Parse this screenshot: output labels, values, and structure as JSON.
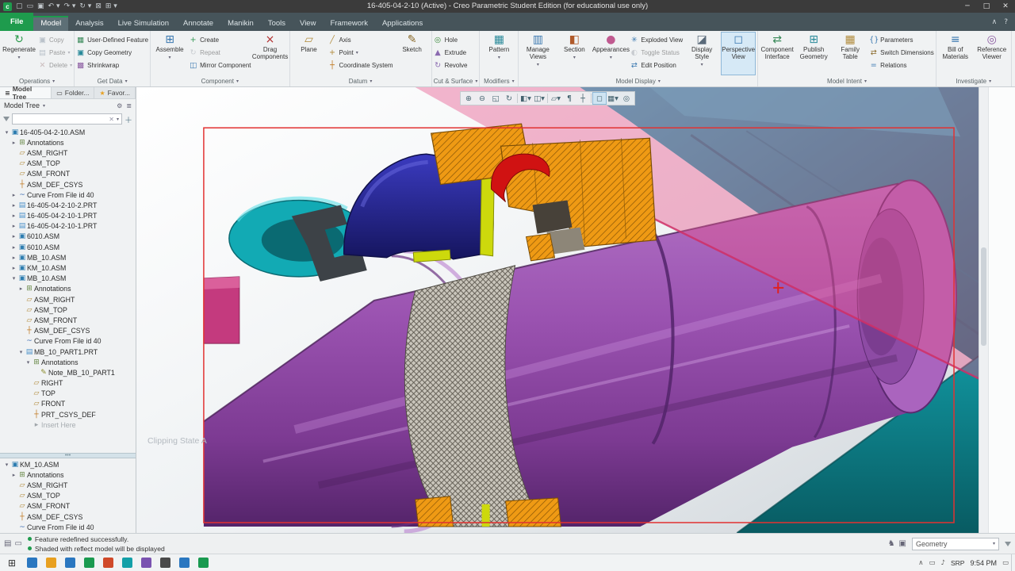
{
  "window": {
    "title": "16-405-04-2-10 (Active) - Creo Parametric Student Edition (for educational use only)",
    "quick_access": [
      {
        "name": "new-file-icon",
        "glyph": "▢"
      },
      {
        "name": "open-icon",
        "glyph": "▭"
      },
      {
        "name": "save-icon",
        "glyph": "▣"
      },
      {
        "name": "undo-icon",
        "glyph": "↶",
        "caret": true
      },
      {
        "name": "redo-icon",
        "glyph": "↷",
        "caret": true
      },
      {
        "name": "regenerate-icon",
        "glyph": "↻",
        "caret": true
      },
      {
        "name": "close-window-icon",
        "glyph": "⊠"
      },
      {
        "name": "windows-icon",
        "glyph": "⊞",
        "caret": true
      }
    ],
    "controls": [
      {
        "name": "minimize-button",
        "glyph": "─"
      },
      {
        "name": "maximize-button",
        "glyph": "□"
      },
      {
        "name": "close-button",
        "glyph": "✕"
      }
    ]
  },
  "colors": {
    "accent_green": "#1e9b4d",
    "shaft_purple": "#9a52b0",
    "housing_teal": "#10a8b2",
    "bearing_orange": "#ef9a14",
    "clip_pink": "#e8538b",
    "part_red": "#d01212",
    "part_blue": "#2a2aa8",
    "part_yellow": "#cdd90c",
    "selection_red": "#e23232"
  },
  "ribbon": {
    "tabs": [
      {
        "label": "File",
        "file": true
      },
      {
        "label": "Model",
        "active": true
      },
      {
        "label": "Analysis"
      },
      {
        "label": "Live Simulation"
      },
      {
        "label": "Annotate"
      },
      {
        "label": "Manikin"
      },
      {
        "label": "Tools"
      },
      {
        "label": "View"
      },
      {
        "label": "Framework"
      },
      {
        "label": "Applications"
      }
    ],
    "right_icons": [
      {
        "name": "minimize-ribbon-icon",
        "glyph": "∧"
      },
      {
        "name": "help-icon",
        "glyph": "?"
      }
    ],
    "groups": [
      {
        "label": "Operations",
        "items": [
          {
            "type": "big",
            "label": "Regenerate",
            "icon": "regenerate-icon",
            "caret": true
          },
          {
            "type": "col",
            "buttons": [
              {
                "label": "Copy",
                "icon": "copy-icon",
                "disabled": true
              },
              {
                "label": "Paste",
                "icon": "paste-icon",
                "disabled": true,
                "caret": true
              },
              {
                "label": "Delete",
                "icon": "delete-icon",
                "disabled": true,
                "caret": true
              }
            ]
          }
        ]
      },
      {
        "label": "Get Data",
        "items": [
          {
            "type": "col",
            "buttons": [
              {
                "label": "User-Defined Feature",
                "icon": "udf-icon"
              },
              {
                "label": "Copy Geometry",
                "icon": "copy-geometry-icon"
              },
              {
                "label": "Shrinkwrap",
                "icon": "shrinkwrap-icon"
              }
            ]
          }
        ]
      },
      {
        "label": "Component",
        "items": [
          {
            "type": "big",
            "label": "Assemble",
            "icon": "assemble-icon",
            "caret": true
          },
          {
            "type": "col",
            "buttons": [
              {
                "label": "Create",
                "icon": "create-icon"
              },
              {
                "label": "Repeat",
                "icon": "repeat-icon",
                "disabled": true
              },
              {
                "label": "Mirror Component",
                "icon": "mirror-icon"
              }
            ]
          },
          {
            "type": "big",
            "label": "Drag Components",
            "icon": "drag-components-icon"
          }
        ]
      },
      {
        "label": "Datum",
        "items": [
          {
            "type": "big",
            "label": "Plane",
            "icon": "plane-icon"
          },
          {
            "type": "col",
            "buttons": [
              {
                "label": "Axis",
                "icon": "axis-icon"
              },
              {
                "label": "Point",
                "icon": "point-icon",
                "caret": true
              },
              {
                "label": "Coordinate System",
                "icon": "csys-icon"
              }
            ]
          },
          {
            "type": "big",
            "label": "Sketch",
            "icon": "sketch-icon"
          }
        ]
      },
      {
        "label": "Cut & Surface",
        "items": [
          {
            "type": "col",
            "buttons": [
              {
                "label": "Hole",
                "icon": "hole-icon"
              },
              {
                "label": "Extrude",
                "icon": "extrude-icon"
              },
              {
                "label": "Revolve",
                "icon": "revolve-icon"
              }
            ]
          }
        ]
      },
      {
        "label": "Modifiers",
        "items": [
          {
            "type": "big",
            "label": "Pattern",
            "icon": "pattern-icon",
            "caret": true
          }
        ]
      },
      {
        "label": "Model Display",
        "items": [
          {
            "type": "big",
            "label": "Manage Views",
            "icon": "manage-views-icon",
            "caret": true
          },
          {
            "type": "big",
            "label": "Section",
            "icon": "section-icon",
            "caret": true
          },
          {
            "type": "big",
            "label": "Appearances",
            "icon": "appearances-icon",
            "caret": true
          },
          {
            "type": "col",
            "buttons": [
              {
                "label": "Exploded View",
                "icon": "exploded-view-icon"
              },
              {
                "label": "Toggle Status",
                "icon": "toggle-status-icon",
                "disabled": true
              },
              {
                "label": "Edit Position",
                "icon": "edit-position-icon"
              }
            ]
          },
          {
            "type": "big",
            "label": "Display Style",
            "icon": "display-style-icon",
            "caret": true
          },
          {
            "type": "big",
            "label": "Perspective View",
            "icon": "perspective-view-icon",
            "active": true
          }
        ]
      },
      {
        "label": "Model Intent",
        "items": [
          {
            "type": "big",
            "label": "Component Interface",
            "icon": "component-interface-icon"
          },
          {
            "type": "big",
            "label": "Publish Geometry",
            "icon": "publish-geometry-icon"
          },
          {
            "type": "big",
            "label": "Family Table",
            "icon": "family-table-icon"
          },
          {
            "type": "col",
            "buttons": [
              {
                "label": "Parameters",
                "icon": "parameters-icon"
              },
              {
                "label": "Switch Dimensions",
                "icon": "switch-dimensions-icon"
              },
              {
                "label": "Relations",
                "icon": "relations-icon"
              }
            ]
          }
        ]
      },
      {
        "label": "Investigate",
        "items": [
          {
            "type": "big",
            "label": "Bill of Materials",
            "icon": "bom-icon"
          },
          {
            "type": "big",
            "label": "Reference Viewer",
            "icon": "reference-viewer-icon"
          }
        ]
      }
    ]
  },
  "left_panel": {
    "tabs": [
      {
        "label": "Model Tree",
        "icon": "tree-icon",
        "glyph": "≡",
        "active": true
      },
      {
        "label": "Folder...",
        "icon": "folder-icon",
        "glyph": "▭"
      },
      {
        "label": "Favor...",
        "icon": "star-icon",
        "glyph": "★"
      }
    ],
    "header": {
      "label": "Model Tree"
    },
    "filter": {
      "placeholder": ""
    },
    "tree1": [
      {
        "label": "16-405-04-2-10.ASM",
        "level": 0,
        "icon": "assembly-icon",
        "expand": "down"
      },
      {
        "label": "Annotations",
        "level": 1,
        "icon": "annotations-icon",
        "expand": "right"
      },
      {
        "label": "ASM_RIGHT",
        "level": 1,
        "icon": "plane-icon"
      },
      {
        "label": "ASM_TOP",
        "level": 1,
        "icon": "plane-icon"
      },
      {
        "label": "ASM_FRONT",
        "level": 1,
        "icon": "plane-icon"
      },
      {
        "label": "ASM_DEF_CSYS",
        "level": 1,
        "icon": "csys-icon"
      },
      {
        "label": "Curve From File id 40",
        "level": 1,
        "icon": "curve-icon",
        "expand": "right"
      },
      {
        "label": "16-405-04-2-10-2.PRT",
        "level": 1,
        "icon": "part-icon",
        "expand": "right"
      },
      {
        "label": "16-405-04-2-10-1.PRT",
        "level": 1,
        "icon": "part-icon",
        "expand": "right"
      },
      {
        "label": "16-405-04-2-10-1.PRT",
        "level": 1,
        "icon": "part-icon",
        "expand": "right"
      },
      {
        "label": "6010.ASM",
        "level": 1,
        "icon": "assembly-icon",
        "expand": "right"
      },
      {
        "label": "6010.ASM",
        "level": 1,
        "icon": "assembly-icon",
        "expand": "right"
      },
      {
        "label": "MB_10.ASM",
        "level": 1,
        "icon": "assembly-icon",
        "expand": "right"
      },
      {
        "label": "KM_10.ASM",
        "level": 1,
        "icon": "assembly-icon",
        "expand": "right"
      },
      {
        "label": "MB_10.ASM",
        "level": 1,
        "icon": "assembly-icon",
        "expand": "down"
      },
      {
        "label": "Annotations",
        "level": 2,
        "icon": "annotations-icon",
        "expand": "right"
      },
      {
        "label": "ASM_RIGHT",
        "level": 2,
        "icon": "plane-icon"
      },
      {
        "label": "ASM_TOP",
        "level": 2,
        "icon": "plane-icon"
      },
      {
        "label": "ASM_FRONT",
        "level": 2,
        "icon": "plane-icon"
      },
      {
        "label": "ASM_DEF_CSYS",
        "level": 2,
        "icon": "csys-icon"
      },
      {
        "label": "Curve From File id 40",
        "level": 2,
        "icon": "curve-icon"
      },
      {
        "label": "MB_10_PART1.PRT",
        "level": 2,
        "icon": "part-icon",
        "expand": "down"
      },
      {
        "label": "Annotations",
        "level": 3,
        "icon": "annotations-icon",
        "expand": "down"
      },
      {
        "label": "Note_MB_10_PART1",
        "level": 4,
        "icon": "note-icon"
      },
      {
        "label": "RIGHT",
        "level": 3,
        "icon": "plane-icon"
      },
      {
        "label": "TOP",
        "level": 3,
        "icon": "plane-icon"
      },
      {
        "label": "FRONT",
        "level": 3,
        "icon": "plane-icon"
      },
      {
        "label": "PRT_CSYS_DEF",
        "level": 3,
        "icon": "csys-icon"
      },
      {
        "label": "Insert Here",
        "level": 3,
        "icon": "insert-icon",
        "grayed": true
      }
    ],
    "tree2": [
      {
        "label": "KM_10.ASM",
        "level": 0,
        "icon": "assembly-icon",
        "expand": "down"
      },
      {
        "label": "Annotations",
        "level": 1,
        "icon": "annotations-icon",
        "expand": "right"
      },
      {
        "label": "ASM_RIGHT",
        "level": 1,
        "icon": "plane-icon"
      },
      {
        "label": "ASM_TOP",
        "level": 1,
        "icon": "plane-icon"
      },
      {
        "label": "ASM_FRONT",
        "level": 1,
        "icon": "plane-icon"
      },
      {
        "label": "ASM_DEF_CSYS",
        "level": 1,
        "icon": "csys-icon"
      },
      {
        "label": "Curve From File id 40",
        "level": 1,
        "icon": "curve-icon"
      }
    ]
  },
  "graphics": {
    "clipping_label": "Clipping State A",
    "toolbar": [
      {
        "name": "zoom-in-icon",
        "glyph": "⊕"
      },
      {
        "name": "zoom-out-icon",
        "glyph": "⊖"
      },
      {
        "name": "refit-icon",
        "glyph": "◱"
      },
      {
        "name": "repaint-icon",
        "glyph": "↻"
      },
      {
        "name": "display-style-icon",
        "glyph": "◧",
        "caret": true,
        "sep": true
      },
      {
        "name": "section-icon",
        "glyph": "◫",
        "caret": true
      },
      {
        "name": "datum-display-icon",
        "glyph": "▱",
        "caret": true,
        "sep": true
      },
      {
        "name": "annotation-display-icon",
        "glyph": "¶"
      },
      {
        "name": "spin-center-icon",
        "glyph": "┼"
      },
      {
        "name": "perspective-icon",
        "glyph": "◻",
        "active": true,
        "sep": true
      },
      {
        "name": "saved-views-icon",
        "glyph": "▦",
        "caret": true
      },
      {
        "name": "view-normal-icon",
        "glyph": "◎"
      }
    ]
  },
  "statusbar": {
    "left_icons": [
      {
        "name": "message-log-icon",
        "glyph": "▤"
      },
      {
        "name": "working-directory-icon",
        "glyph": "▭"
      }
    ],
    "messages": [
      "Feature redefined successfully.",
      "Shaded with reflect model will be displayed"
    ],
    "right_icons": [
      {
        "name": "modelcheck-icon",
        "glyph": "♞"
      },
      {
        "name": "model-notifications-icon",
        "glyph": "▣"
      }
    ],
    "search_combo": {
      "value": "Geometry"
    },
    "filter_icon": "selection-filter-icon"
  },
  "taskbar": {
    "start": {
      "name": "start-button",
      "glyph": "⊞"
    },
    "apps": [
      {
        "name": "app-icon-1",
        "color": "#2a77c0"
      },
      {
        "name": "app-icon-2",
        "color": "#e8a020"
      },
      {
        "name": "app-icon-3",
        "color": "#2a77c0"
      },
      {
        "name": "app-icon-4",
        "color": "#1a9a50"
      },
      {
        "name": "app-icon-5",
        "color": "#d04a2a"
      },
      {
        "name": "app-icon-6",
        "color": "#14a0a8"
      },
      {
        "name": "app-icon-7",
        "color": "#7a52b0"
      },
      {
        "name": "app-icon-8",
        "color": "#4a4a4a"
      },
      {
        "name": "app-icon-9",
        "color": "#2a77c0"
      },
      {
        "name": "app-icon-10",
        "color": "#1a9a50"
      }
    ],
    "tray_icons": [
      {
        "name": "tray-chevron-icon",
        "glyph": "∧"
      },
      {
        "name": "tray-network-icon",
        "glyph": "▭"
      },
      {
        "name": "tray-volume-icon",
        "glyph": "♪"
      }
    ],
    "language": "SRP",
    "clock": "9:54 PM",
    "notification": {
      "name": "action-center-icon",
      "glyph": "▭"
    }
  }
}
